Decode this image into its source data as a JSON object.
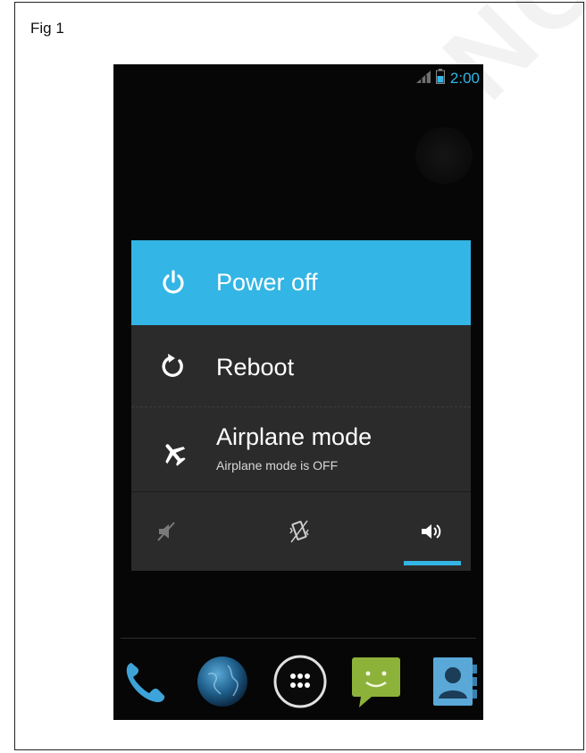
{
  "figure": {
    "label": "Fig 1"
  },
  "status_bar": {
    "time": "2:00",
    "icons": [
      "signal-icon",
      "battery-icon"
    ],
    "accent": "#33b5e5"
  },
  "power_menu": {
    "items": [
      {
        "label": "Power off",
        "icon": "power-icon",
        "selected": true
      },
      {
        "label": "Reboot",
        "icon": "reboot-icon",
        "selected": false
      },
      {
        "label": "Airplane mode",
        "sublabel": "Airplane mode is OFF",
        "icon": "airplane-icon",
        "selected": false
      }
    ],
    "sound_modes": [
      {
        "icon": "silent-icon",
        "active": false
      },
      {
        "icon": "vibrate-icon",
        "active": false
      },
      {
        "icon": "sound-on-icon",
        "active": true
      }
    ],
    "highlight_color": "#33b5e5",
    "background_color": "#2b2b2b"
  },
  "dock": {
    "items": [
      "phone-icon",
      "browser-icon",
      "app-drawer-icon",
      "messaging-icon",
      "contacts-icon"
    ]
  }
}
